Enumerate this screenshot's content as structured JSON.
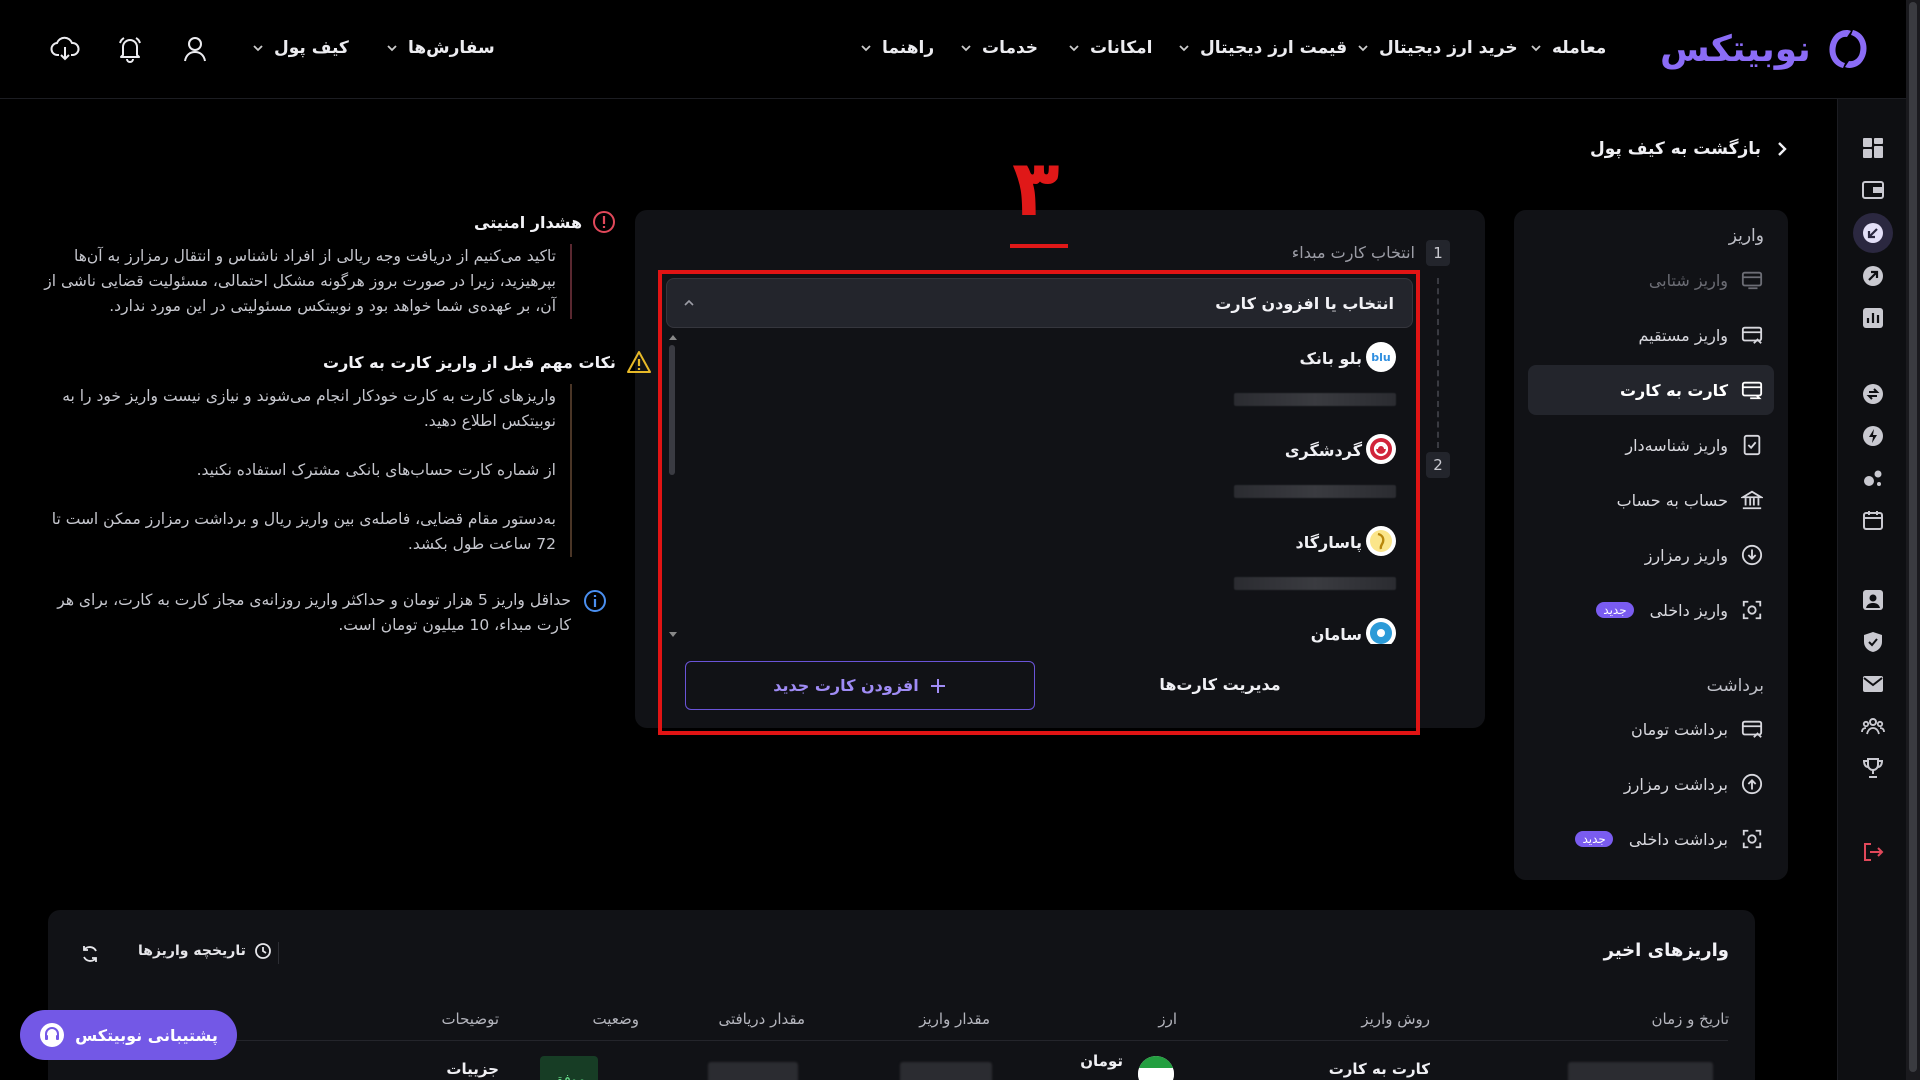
{
  "brand": {
    "logo_text": "نوبیتکس",
    "accent": "#8b6cf6"
  },
  "header": {
    "nav": [
      "معامله",
      "خرید ارز دیجیتال",
      "قیمت ارز دیجیتال",
      "امکانات",
      "خدمات",
      "راهنما"
    ],
    "right_menu": [
      "سفارش‌ها",
      "کیف پول"
    ],
    "icons": [
      "user-icon",
      "bell-icon",
      "download-app-icon"
    ]
  },
  "back_link": "بازگشت به کیف پول",
  "sidebar": {
    "deposit_title": "واریز",
    "deposit_items": [
      {
        "label": "واریز شتابی",
        "icon": "card-fast-icon",
        "state": "disabled"
      },
      {
        "label": "واریز مستقیم",
        "icon": "card-direct-icon",
        "state": "normal"
      },
      {
        "label": "کارت به کارت",
        "icon": "card-transfer-icon",
        "state": "active"
      },
      {
        "label": "واریز شناسه‌دار",
        "icon": "id-deposit-icon",
        "state": "normal"
      },
      {
        "label": "حساب به حساب",
        "icon": "bank-icon",
        "state": "normal"
      },
      {
        "label": "واریز رمزارز",
        "icon": "crypto-deposit-icon",
        "state": "normal"
      },
      {
        "label": "واریز داخلی",
        "icon": "internal-deposit-icon",
        "state": "normal",
        "badge": "جدید"
      }
    ],
    "withdraw_title": "برداشت",
    "withdraw_items": [
      {
        "label": "برداشت تومان",
        "icon": "toman-withdraw-icon"
      },
      {
        "label": "برداشت رمزارز",
        "icon": "crypto-withdraw-icon"
      },
      {
        "label": "برداشت داخلی",
        "icon": "internal-withdraw-icon",
        "badge": "جدید"
      }
    ]
  },
  "steps": {
    "step1_num": "1",
    "step1_label": "انتخاب کارت مبداء",
    "step2_num": "2"
  },
  "annotation": {
    "label": "۳",
    "color": "#e01818"
  },
  "card_select": {
    "placeholder": "انتخاب یا افزودن کارت",
    "banks": [
      {
        "name": "بلو بانک",
        "logo": "blu",
        "logo_color": "#2f8fe0"
      },
      {
        "name": "گردشگری",
        "logo": "",
        "logo_color": "#d1243a"
      },
      {
        "name": "پاسارگاد",
        "logo": "",
        "logo_color": "#e7b928"
      },
      {
        "name": "سامان",
        "logo": "",
        "logo_color": "#2c9bd8"
      }
    ],
    "manage_label": "مدیریت کارت‌ها",
    "add_label": "افزودن کارت جدید"
  },
  "notices": {
    "security_title": "هشدار امنیتی",
    "security_body": "تاکید می‌کنیم از دریافت وجه ریالی از افراد ناشناس و انتقال رمزارز به آن‌ها بپرهیزید، زیرا در صورت بروز هرگونه مشکل احتمالی، مسئولیت قضایی ناشی از آن، بر عهده‌ی شما خواهد بود و نوبیتکس مسئولیتی در این مورد ندارد.",
    "tips_title": "نکات مهم قبل از واریز کارت به کارت",
    "tips": [
      "واریزهای کارت به کارت خودکار انجام می‌شوند و نیازی نیست واریز خود را به نوبیتکس اطلاع دهید.",
      "از شماره کارت حساب‌های بانکی مشترک استفاده نکنید.",
      "به‌دستور مقام قضایی، فاصله‌ی بین واریز ریال و برداشت رمزارز ممکن است تا 72 ساعت طول بکشد."
    ],
    "limit_text": "حداقل واریز 5 هزار تومان و حداکثر واریز روزانه‌ی مجاز کارت به کارت، برای هر کارت مبداء، 10 میلیون تومان است."
  },
  "deposits": {
    "title": "واریزهای اخیر",
    "history_label": "تاریخچه واریزها",
    "columns": [
      "تاریخ و زمان",
      "روش واریز",
      "ارز",
      "مقدار واریز",
      "مقدار دریافتی",
      "وضعیت",
      "توضیحات"
    ],
    "row": {
      "method": "کارت به کارت",
      "currency": "تومان",
      "status": "موفق",
      "details": "جزییات"
    }
  },
  "support_label": "پشتیبانی نوبیتکس"
}
